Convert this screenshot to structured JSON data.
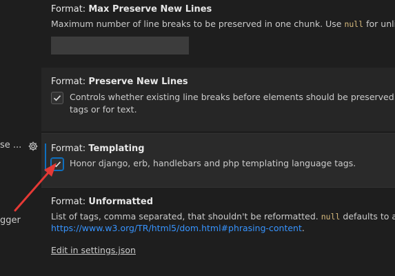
{
  "left_panel": {
    "truncated_item_1": "se ...",
    "truncated_item_2": "gger"
  },
  "settings": [
    {
      "prefix": "Format: ",
      "name": "Max Preserve New Lines",
      "desc_before": "Maximum number of line breaks to be preserved in one chunk. Use ",
      "code": "null",
      "desc_after": " for unlimited.",
      "input_value": ""
    },
    {
      "prefix": "Format: ",
      "name": "Preserve New Lines",
      "checked": true,
      "desc_line1": "Controls whether existing line breaks before elements should be preserved. Only w",
      "desc_line2": "tags or for text."
    },
    {
      "prefix": "Format: ",
      "name": "Templating",
      "checked": true,
      "desc": "Honor django, erb, handlebars and php templating language tags."
    },
    {
      "prefix": "Format: ",
      "name": "Unformatted",
      "desc_before": "List of tags, comma separated, that shouldn't be reformatted. ",
      "code": "null",
      "desc_after": " defaults to all tags l",
      "link": "https://www.w3.org/TR/html5/dom.html#phrasing-content",
      "link_suffix": ".",
      "edit_link": "Edit in settings.json"
    }
  ],
  "colors": {
    "background": "#1e1e1e",
    "focus": "#0e70c0",
    "link": "#3794ff",
    "code": "#d7ba7d",
    "arrow": "#e53935"
  },
  "icons": {
    "gear": "gear-icon",
    "check": "check-icon"
  }
}
